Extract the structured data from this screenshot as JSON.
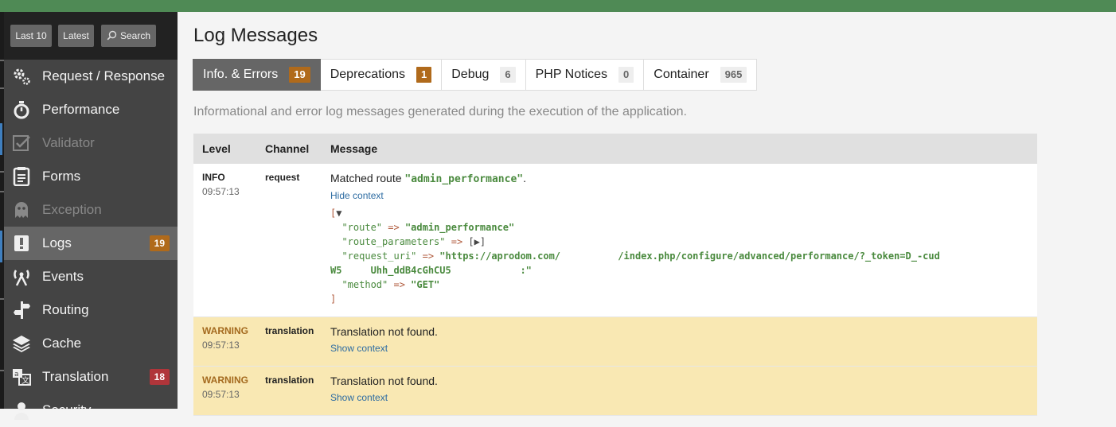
{
  "toolbar": {
    "last10": "Last 10",
    "latest": "Latest",
    "search": "Search"
  },
  "sidebar": {
    "items": [
      {
        "label": "Request / Response",
        "icon": "gears-icon",
        "state": "normal"
      },
      {
        "label": "Performance",
        "icon": "stopwatch-icon",
        "state": "normal"
      },
      {
        "label": "Validator",
        "icon": "checkbox-icon",
        "state": "disabled"
      },
      {
        "label": "Forms",
        "icon": "form-icon",
        "state": "normal"
      },
      {
        "label": "Exception",
        "icon": "ghost-icon",
        "state": "disabled"
      },
      {
        "label": "Logs",
        "icon": "log-icon",
        "state": "active",
        "badge": "19",
        "badge_color": "#b06a1b"
      },
      {
        "label": "Events",
        "icon": "antenna-icon",
        "state": "normal"
      },
      {
        "label": "Routing",
        "icon": "signpost-icon",
        "state": "normal"
      },
      {
        "label": "Cache",
        "icon": "layers-icon",
        "state": "normal"
      },
      {
        "label": "Translation",
        "icon": "translate-icon",
        "state": "normal",
        "badge": "18",
        "badge_color": "#b0353a"
      },
      {
        "label": "Security",
        "icon": "user-icon",
        "state": "normal"
      }
    ]
  },
  "main": {
    "title": "Log Messages",
    "description": "Informational and error log messages generated during the execution of the application.",
    "tabs": [
      {
        "label": "Info. & Errors",
        "count": "19",
        "active": true
      },
      {
        "label": "Deprecations",
        "count": "1",
        "active": false
      },
      {
        "label": "Debug",
        "count": "6",
        "active": false
      },
      {
        "label": "PHP Notices",
        "count": "0",
        "active": false
      },
      {
        "label": "Container",
        "count": "965",
        "active": false
      }
    ],
    "table": {
      "headers": {
        "level": "Level",
        "channel": "Channel",
        "message": "Message"
      },
      "rows": [
        {
          "level": "INFO",
          "time": "09:57:13",
          "channel": "request",
          "message_prefix": "Matched route ",
          "message_value": "\"admin_performance\"",
          "message_suffix": ".",
          "context_link": "Hide context",
          "context": {
            "open": "[",
            "route_key": "\"route\"",
            "route_val": "\"admin_performance\"",
            "params_key": "\"route_parameters\"",
            "params_val": "[▶]",
            "uri_key": "\"request_uri\"",
            "uri_val_1": "\"https://aprodom.com/",
            "uri_val_2": "/index.php/configure/advanced/performance/?_token=D_-cud",
            "uri_val_3": "W5",
            "uri_val_4": "Uhh_ddB4cGhCU5",
            "uri_val_5": ":\"",
            "method_key": "\"method\"",
            "method_val": "\"GET\"",
            "close": "]",
            "arrow": "=>"
          }
        },
        {
          "level": "WARNING",
          "time": "09:57:13",
          "channel": "translation",
          "message": "Translation not found.",
          "context_link": "Show context"
        },
        {
          "level": "WARNING",
          "time": "09:57:13",
          "channel": "translation",
          "message": "Translation not found.",
          "context_link": "Show context"
        }
      ]
    }
  },
  "colors": {
    "topbar": "#4f8a55",
    "sidebar": "#444444",
    "active_tab": "#666666",
    "warning_row": "#f9e8b3",
    "string_green": "#4a8a3e"
  }
}
